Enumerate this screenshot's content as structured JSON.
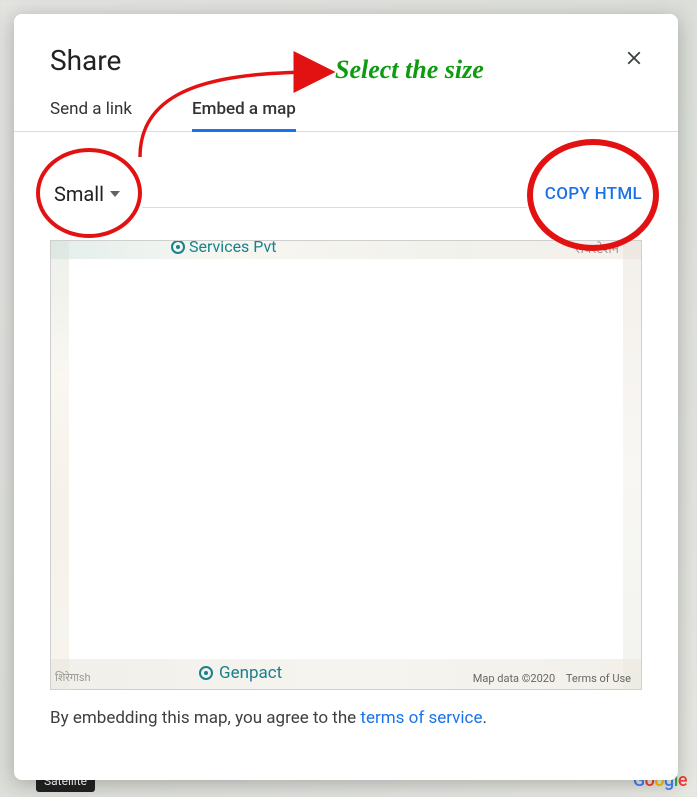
{
  "dialog": {
    "title": "Share",
    "tabs": {
      "send_link": "Send a link",
      "embed_map": "Embed a map"
    },
    "size_dropdown": {
      "selected": "Small"
    },
    "copy_button": "COPY HTML",
    "footer_text_prefix": "By embedding this map, you agree to the ",
    "footer_link_text": "terms of service",
    "footer_text_suffix": "."
  },
  "annotation": {
    "text": "Select the size"
  },
  "map_preview": {
    "top_label": "Services Pvt",
    "top_right_label": "सबस्टेशन",
    "bottom_label": "Genpact",
    "attribution_map": "Map data ©2020",
    "attribution_terms": "Terms of Use",
    "bottom_left": "शिरेगाsh"
  },
  "background": {
    "satellite_label": "Satellite",
    "logo_letters": [
      "G",
      "o",
      "o",
      "g",
      "l",
      "e"
    ]
  }
}
